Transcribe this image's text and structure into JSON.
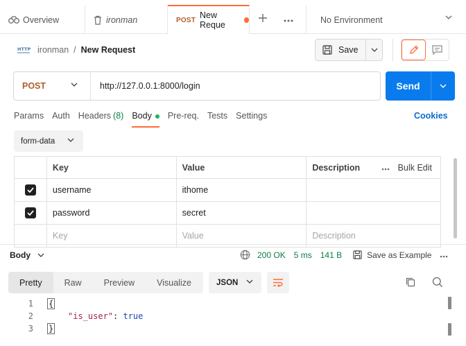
{
  "tabs": [
    {
      "label": "Overview"
    },
    {
      "label": "ironman"
    },
    {
      "method": "POST",
      "label": "New Reque"
    }
  ],
  "environment": {
    "label": "No Environment"
  },
  "breadcrumb": {
    "collection": "ironman",
    "separator": "/",
    "request": "New Request"
  },
  "toolbar": {
    "save_label": "Save"
  },
  "request": {
    "method": "POST",
    "url": "http://127.0.0.1:8000/login",
    "send_label": "Send"
  },
  "request_tabs": [
    {
      "label": "Params"
    },
    {
      "label": "Auth"
    },
    {
      "label": "Headers",
      "count": "(8)"
    },
    {
      "label": "Body"
    },
    {
      "label": "Pre-req."
    },
    {
      "label": "Tests"
    },
    {
      "label": "Settings"
    }
  ],
  "cookies_label": "Cookies",
  "body_type": "form-data",
  "table": {
    "headers": {
      "key": "Key",
      "value": "Value",
      "description": "Description",
      "bulk": "Bulk Edit"
    },
    "rows": [
      {
        "key": "username",
        "value": "ithome"
      },
      {
        "key": "password",
        "value": "secret"
      }
    ],
    "placeholders": {
      "key": "Key",
      "value": "Value",
      "description": "Description"
    }
  },
  "response": {
    "label": "Body",
    "status": "200 OK",
    "time": "5 ms",
    "size": "141 B",
    "save_example": "Save as Example",
    "format_tabs": [
      "Pretty",
      "Raw",
      "Preview",
      "Visualize"
    ],
    "format": "JSON",
    "lines": [
      {
        "n": "1",
        "open": "{"
      },
      {
        "n": "2",
        "key": "\"is_user\"",
        "colon": ": ",
        "value": "true"
      },
      {
        "n": "3",
        "close": "}"
      }
    ]
  },
  "colors": {
    "accent": "#ff6c37",
    "send": "#097bed",
    "status_ok": "#0e7c45"
  }
}
